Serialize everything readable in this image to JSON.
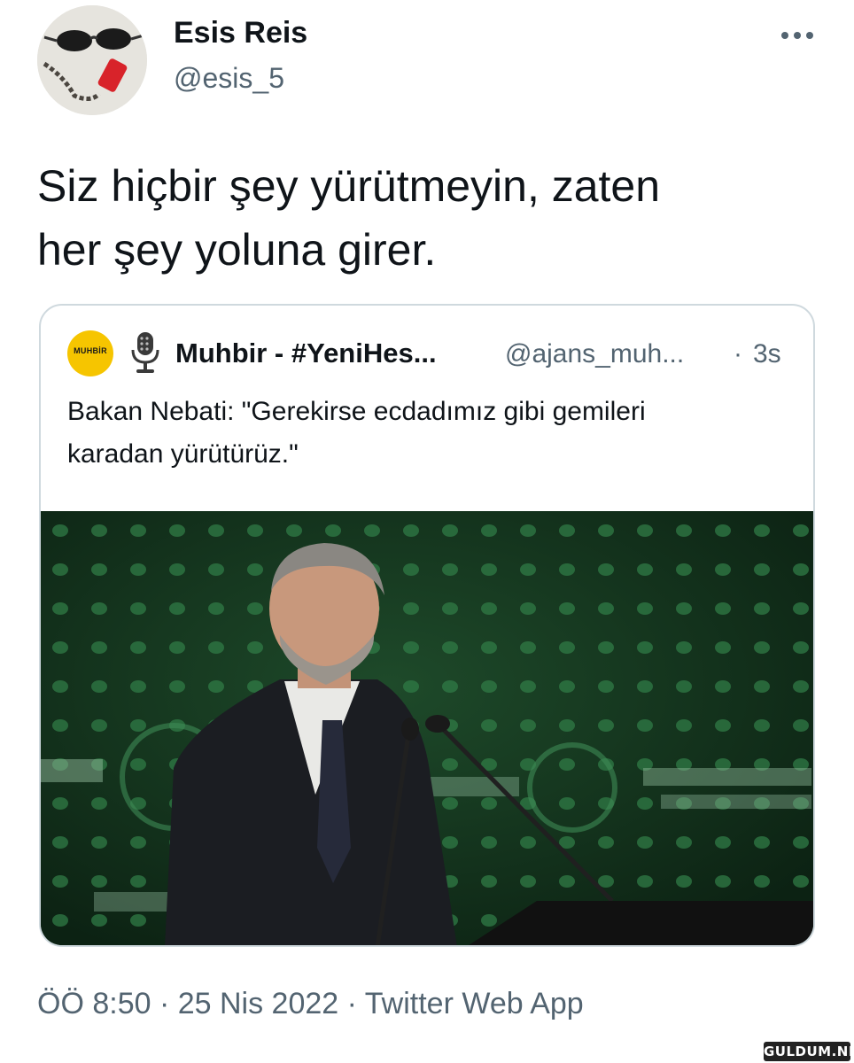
{
  "tweet": {
    "author": {
      "name": "Esis Reis",
      "handle": "@esis_5",
      "avatar_icon": "avatar-photo"
    },
    "more_icon": "more-horizontal-icon",
    "text_lines": [
      "Siz hiçbir şey yürütmeyin, zaten",
      "her şey yoluna girer."
    ],
    "meta": "ÖÖ 8:50 · 25 Nis 2022 · Twitter Web App"
  },
  "quote": {
    "logo_text": "MUHBİR",
    "logo_color": "#f6c500",
    "mic_icon": "microphone-icon",
    "name": "Muhbir - #YeniHes...",
    "handle": "@ajans_muh...",
    "separator": "·",
    "time": "3s",
    "text_lines": [
      "Bakan Nebati: \"Gerekirse ecdadımız gibi gemileri",
      "karadan yürütürüz.\""
    ],
    "photo_icon": "speaker-at-podium-photo"
  },
  "watermark": "GULDUM.NET",
  "colors": {
    "text": "#0f1419",
    "secondary": "#536471",
    "border": "#cfd9de",
    "photo_bg": "#123019"
  }
}
